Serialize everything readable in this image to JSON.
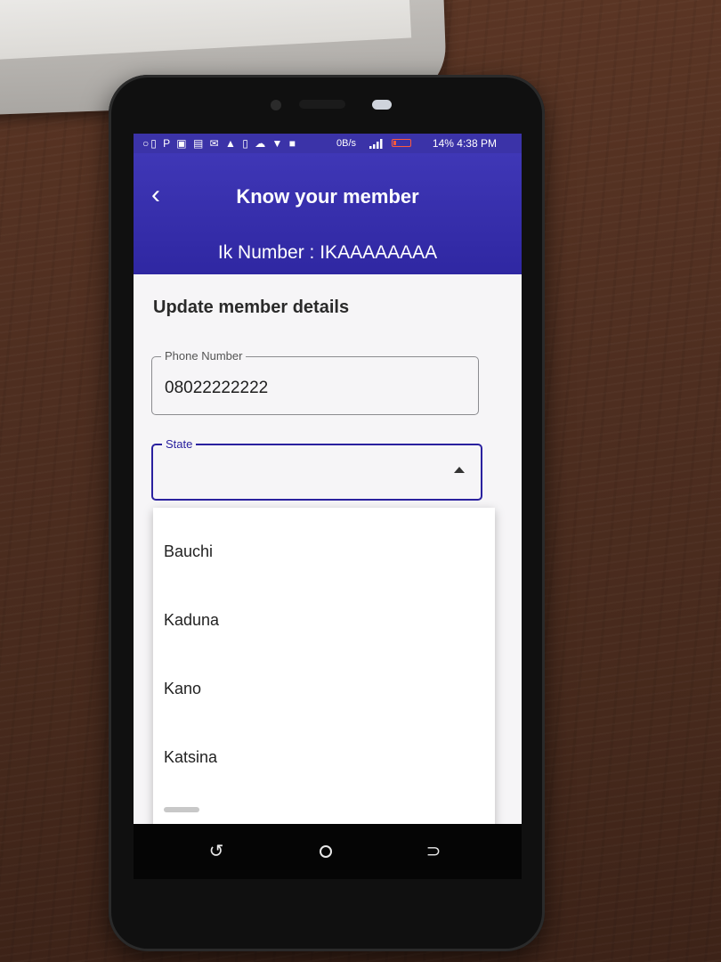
{
  "status_bar": {
    "left_icons": "○▯ P ▣ ▤ ✉ ▲ ▯ ☁ ▼ ■",
    "speed": "0B/s",
    "battery": "14%",
    "time": "4:38 PM"
  },
  "app_bar": {
    "title": "Know your member",
    "ik_number": "Ik Number : IKAAAAAAAA"
  },
  "form": {
    "section_title": "Update member details",
    "phone_label": "Phone Number",
    "phone_value": "08022222222",
    "state_label": "State",
    "state_value": ""
  },
  "dropdown": {
    "options": [
      "Bauchi",
      "Kaduna",
      "Kano",
      "Katsina"
    ]
  },
  "colors": {
    "primary": "#2f27a2",
    "focus_border": "#2a219f"
  },
  "icons": {
    "back": "chevron-left-icon",
    "dropdown": "arrow-up-icon",
    "nav_back": "back-icon",
    "nav_home": "home-icon",
    "nav_recent": "recent-apps-icon"
  }
}
